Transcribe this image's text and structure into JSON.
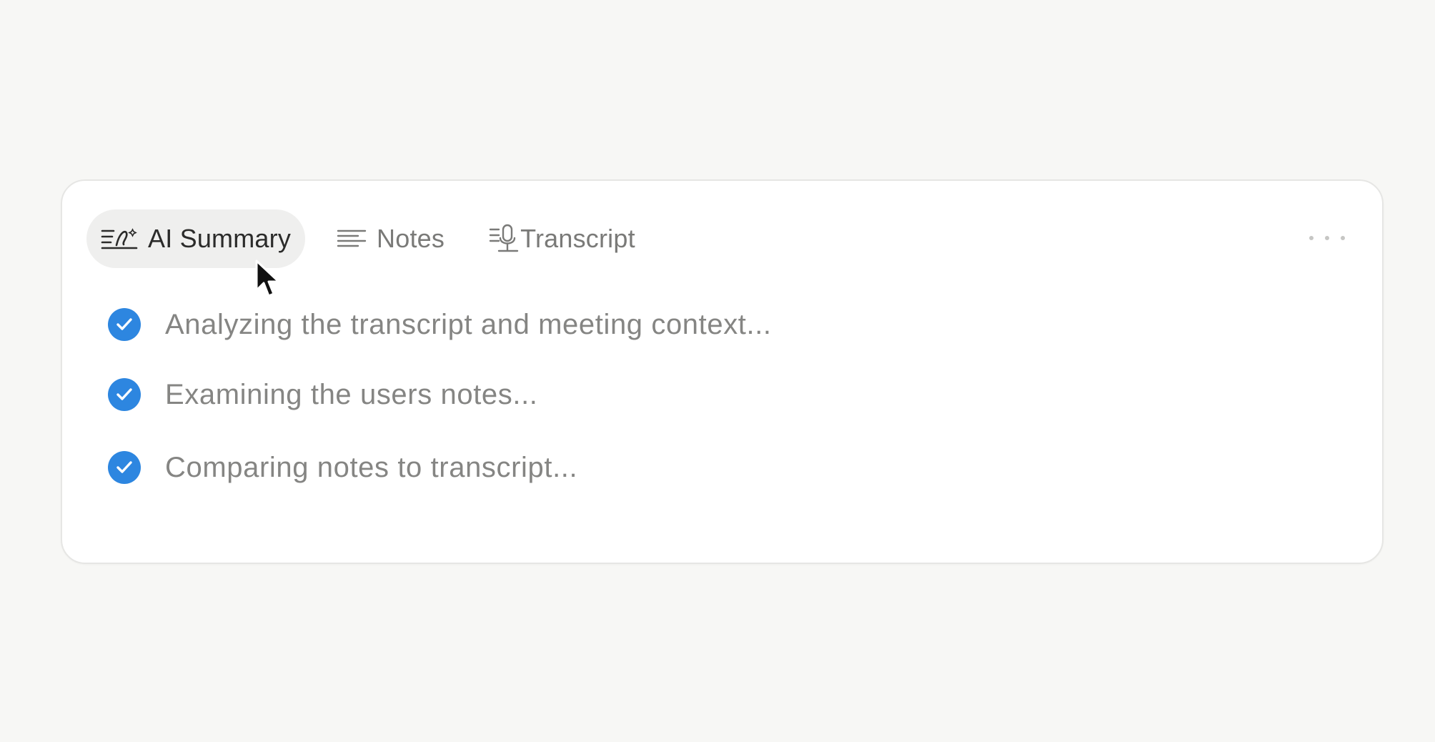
{
  "tabs": {
    "ai_summary": {
      "label": "AI Summary",
      "icon": "ai-summary-icon",
      "active": true
    },
    "notes": {
      "label": "Notes",
      "icon": "notes-lines-icon"
    },
    "transcript": {
      "label": "Transcript",
      "icon": "transcript-mic-icon"
    }
  },
  "more_menu": {
    "icon": "more-horizontal-icon"
  },
  "steps": [
    {
      "text": "Analyzing the transcript and meeting context...",
      "status": "done"
    },
    {
      "text": "Examining the users notes...",
      "status": "done"
    },
    {
      "text": "Comparing notes to transcript...",
      "status": "done"
    }
  ],
  "colors": {
    "check_accent": "#2d86e0",
    "active_tab_bg": "#efefee",
    "background": "#f7f7f5"
  }
}
